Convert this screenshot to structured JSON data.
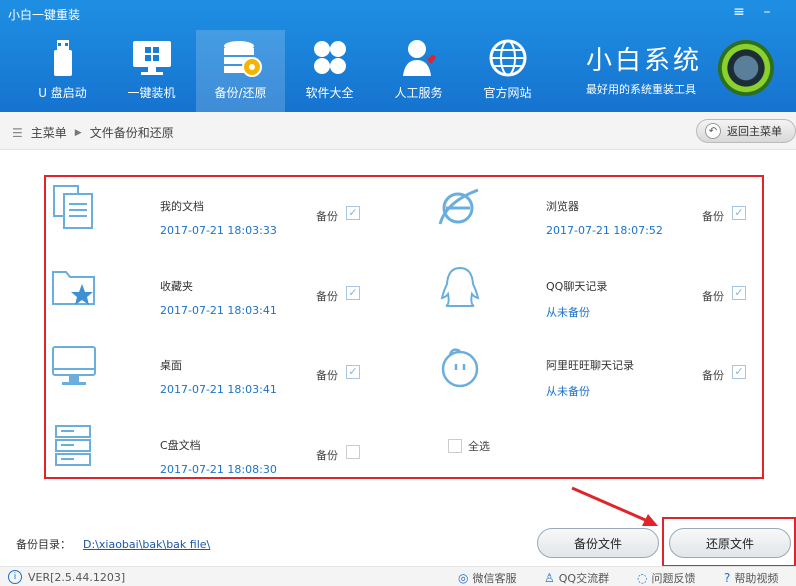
{
  "window": {
    "title": "小白一键重装",
    "menu_icon": "hamburger-icon",
    "minimize_icon": "minimize-icon"
  },
  "nav": [
    {
      "label": "U 盘启动",
      "icon": "usb-icon"
    },
    {
      "label": "一键装机",
      "icon": "windows-monitor-icon"
    },
    {
      "label": "备份/还原",
      "icon": "database-icon",
      "active": true
    },
    {
      "label": "软件大全",
      "icon": "software-grid-icon"
    },
    {
      "label": "人工服务",
      "icon": "person-heart-icon"
    },
    {
      "label": "官方网站",
      "icon": "globe-icon"
    }
  ],
  "brand": {
    "name": "小白系统",
    "slogan": "最好用的系统重装工具"
  },
  "breadcrumb": {
    "root": "主菜单",
    "current": "文件备份和还原"
  },
  "back_button": "返回主菜单",
  "backup_label": "备份",
  "items": [
    {
      "name": "我的文档",
      "time": "2017-07-21 18:03:33",
      "checked": true,
      "icon": "documents-icon"
    },
    {
      "name": "浏览器",
      "time": "2017-07-21 18:07:52",
      "checked": true,
      "icon": "browser-icon"
    },
    {
      "name": "收藏夹",
      "time": "2017-07-21 18:03:41",
      "checked": true,
      "icon": "favorites-folder-icon"
    },
    {
      "name": "QQ聊天记录",
      "time": "从未备份",
      "checked": true,
      "icon": "qq-icon"
    },
    {
      "name": "桌面",
      "time": "2017-07-21 18:03:41",
      "checked": true,
      "icon": "desktop-monitor-icon"
    },
    {
      "name": "阿里旺旺聊天记录",
      "time": "从未备份",
      "checked": true,
      "icon": "wangwang-icon"
    },
    {
      "name": "C盘文档",
      "time": "2017-07-21 18:08:30",
      "checked": false,
      "icon": "server-drive-icon"
    }
  ],
  "select_all": "全选",
  "backup_dir": {
    "label": "备份目录：",
    "path": "D:\\xiaobai\\bak\\bak file\\"
  },
  "buttons": {
    "backup": "备份文件",
    "restore": "还原文件"
  },
  "footer": {
    "version": "VER[2.5.44.1203]",
    "links": [
      {
        "label": "微信客服",
        "icon": "wechat-icon"
      },
      {
        "label": "QQ交流群",
        "icon": "qq-small-icon"
      },
      {
        "label": "问题反馈",
        "icon": "chat-bubble-icon"
      },
      {
        "label": "帮助视频",
        "icon": "help-icon"
      }
    ]
  },
  "colors": {
    "header": "#1a80dc",
    "highlight": "#e0242b",
    "link": "#1a73c9"
  }
}
